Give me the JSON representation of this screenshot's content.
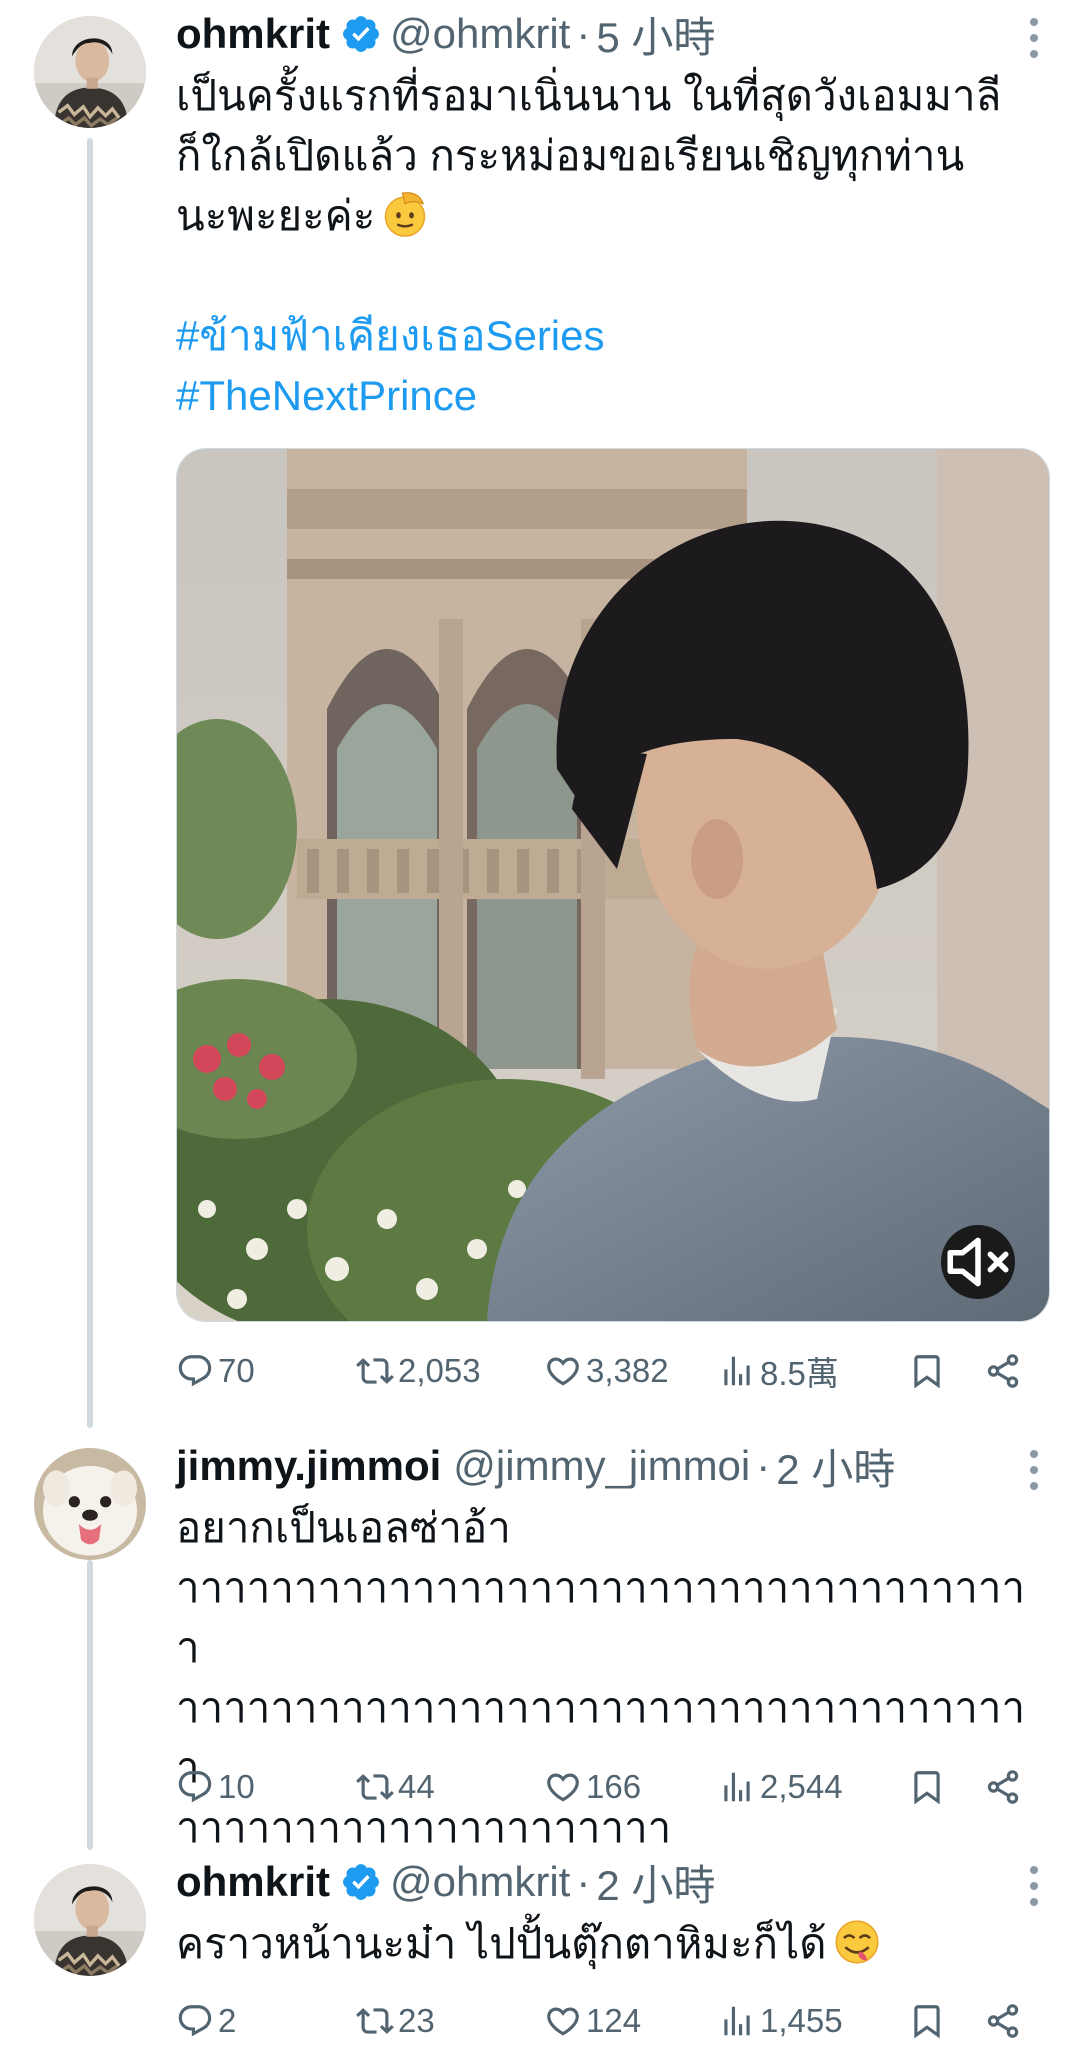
{
  "tweets": [
    {
      "name": "ohmkrit",
      "verified": true,
      "handle": "@ohmkrit",
      "separator": "·",
      "time": "5 小時",
      "text": "เป็นครั้งแรกที่รอมาเนิ่นนาน ในที่สุดวังเอมมาลี\nก็ใกล้เปิดแล้ว กระหม่อมขอเรียนเชิญทุกท่าน\nนะพะยะค่ะ",
      "emoji": "saluting-face",
      "hashtags": [
        "#ข้ามฟ้าเคียงเธอSeries",
        "#TheNextPrince"
      ],
      "media": {
        "type": "video",
        "muted": true
      },
      "stats": {
        "replies": "70",
        "reposts": "2,053",
        "likes": "3,382",
        "views": "8.5萬"
      }
    },
    {
      "name": "jimmy.jimmoi",
      "verified": false,
      "handle": "@jimmy_jimmoi",
      "separator": "·",
      "time": "2 小時",
      "text": "อยากเป็นเอลซ่าอ้า\nาาาาาาาาาาาาาาาาาาาาาาาาาาาาาาาาาาาาา\nาาาาาาาาาาาาาาาาาาาาาาาาาาาาาาาาาาาาา\nาาาาาาาาาาาาาาาาาาาาา",
      "stats": {
        "replies": "10",
        "reposts": "44",
        "likes": "166",
        "views": "2,544"
      }
    },
    {
      "name": "ohmkrit",
      "verified": true,
      "handle": "@ohmkrit",
      "separator": "·",
      "time": "2 小時",
      "text": "คราวหน้านะม๋า ไปปั้นตุ๊กตาหิมะก็ได้",
      "emoji": "face-savoring-food",
      "stats": {
        "replies": "2",
        "reposts": "23",
        "likes": "124",
        "views": "1,455"
      }
    }
  ],
  "colors": {
    "text": "#0f1419",
    "secondary": "#536471",
    "link": "#1d9bf0",
    "thread_line": "#cfd9de"
  },
  "icons": [
    "more-icon",
    "verified-icon",
    "reply-icon",
    "repost-icon",
    "like-icon",
    "views-icon",
    "bookmark-icon",
    "share-icon",
    "mute-icon"
  ]
}
